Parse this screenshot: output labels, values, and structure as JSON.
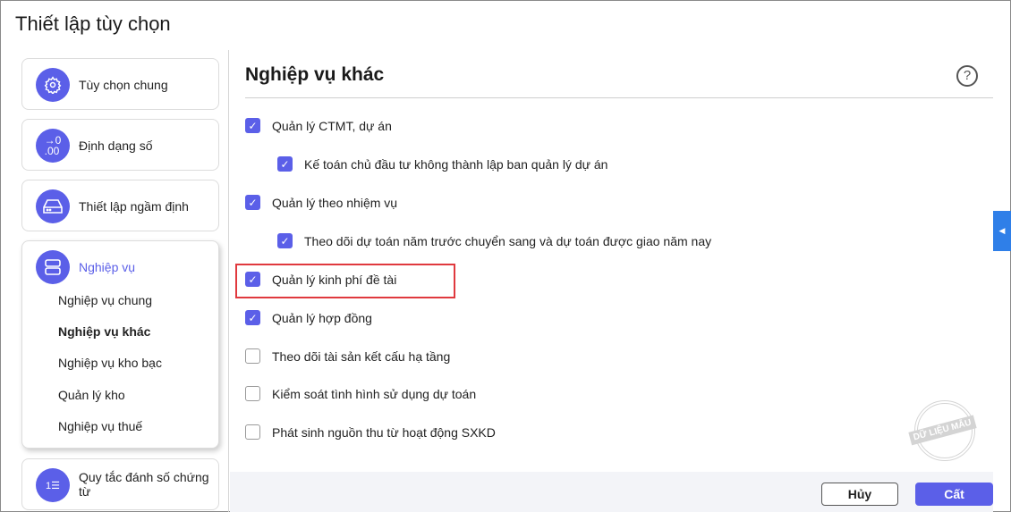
{
  "title": "Thiết lập tùy chọn",
  "sidebar": {
    "items": [
      {
        "label": "Tùy chọn chung",
        "icon": "gear-icon"
      },
      {
        "label": "Định dạng số",
        "icon": "number-format-icon",
        "icon_text": "→0\n.00"
      },
      {
        "label": "Thiết lập ngầm định",
        "icon": "drive-icon"
      },
      {
        "label": "Nghiệp vụ",
        "icon": "server-icon"
      },
      {
        "label": "Quy tắc đánh số chứng từ",
        "icon": "numbered-list-icon"
      }
    ],
    "sub_items": [
      "Nghiệp vụ chung",
      "Nghiệp vụ khác",
      "Nghiệp vụ kho bạc",
      "Quản lý kho",
      "Nghiệp vụ thuế"
    ]
  },
  "main": {
    "heading": "Nghiệp vụ khác",
    "options": [
      {
        "label": "Quản lý CTMT, dự án",
        "checked": true
      },
      {
        "label": "Kế toán chủ đầu tư không thành lập ban quản lý dự án",
        "checked": true
      },
      {
        "label": "Quản lý theo nhiệm vụ",
        "checked": true
      },
      {
        "label": "Theo dõi dự toán năm trước chuyển sang và dự toán được giao năm nay",
        "checked": true
      },
      {
        "label": "Quản lý kinh phí đề tài",
        "checked": true
      },
      {
        "label": "Quản lý hợp đồng",
        "checked": true
      },
      {
        "label": "Theo dõi tài sản kết cấu hạ tầng",
        "checked": false
      },
      {
        "label": "Kiểm soát tình hình sử dụng dự toán",
        "checked": false
      },
      {
        "label": "Phát sinh nguồn thu từ hoạt động SXKD",
        "checked": false
      }
    ]
  },
  "footer": {
    "cancel": "Hủy",
    "save": "Cất"
  },
  "stamp": "DỮ LIỆU MẪU",
  "accent": "#5b5fe8"
}
